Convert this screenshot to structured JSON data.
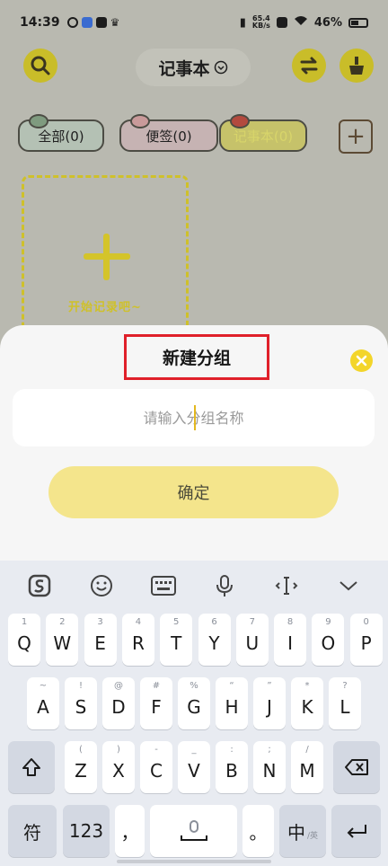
{
  "status_bar": {
    "time": "14:39",
    "net_speed": "65.4",
    "net_unit": "KB/s",
    "battery": "46%"
  },
  "header": {
    "title": "记事本"
  },
  "categories": [
    {
      "label": "全部(0)"
    },
    {
      "label": "便签(0)"
    },
    {
      "label": "记事本(0)"
    }
  ],
  "new_card": {
    "label": "开始记录吧~"
  },
  "sheet": {
    "title": "新建分组",
    "input_placeholder": "请输入分组名称",
    "confirm_label": "确定"
  },
  "keyboard": {
    "row1": [
      {
        "hint": "1",
        "label": "Q"
      },
      {
        "hint": "2",
        "label": "W"
      },
      {
        "hint": "3",
        "label": "E"
      },
      {
        "hint": "4",
        "label": "R"
      },
      {
        "hint": "5",
        "label": "T"
      },
      {
        "hint": "6",
        "label": "Y"
      },
      {
        "hint": "7",
        "label": "U"
      },
      {
        "hint": "8",
        "label": "I"
      },
      {
        "hint": "9",
        "label": "O"
      },
      {
        "hint": "0",
        "label": "P"
      }
    ],
    "row2": [
      {
        "hint": "~",
        "label": "A"
      },
      {
        "hint": "!",
        "label": "S"
      },
      {
        "hint": "@",
        "label": "D"
      },
      {
        "hint": "#",
        "label": "F"
      },
      {
        "hint": "%",
        "label": "G"
      },
      {
        "hint": "“",
        "label": "H"
      },
      {
        "hint": "”",
        "label": "J"
      },
      {
        "hint": "*",
        "label": "K"
      },
      {
        "hint": "?",
        "label": "L"
      }
    ],
    "row3": [
      {
        "hint": "(",
        "label": "Z"
      },
      {
        "hint": ")",
        "label": "X"
      },
      {
        "hint": "-",
        "label": "C"
      },
      {
        "hint": "_",
        "label": "V"
      },
      {
        "hint": ":",
        "label": "B"
      },
      {
        "hint": ";",
        "label": "N"
      },
      {
        "hint": "/",
        "label": "M"
      }
    ],
    "symbol_key": "符",
    "number_key": "123",
    "comma_key": "，",
    "period_key": "。",
    "lang_key": "中",
    "lang_key_sub": "/英"
  }
}
